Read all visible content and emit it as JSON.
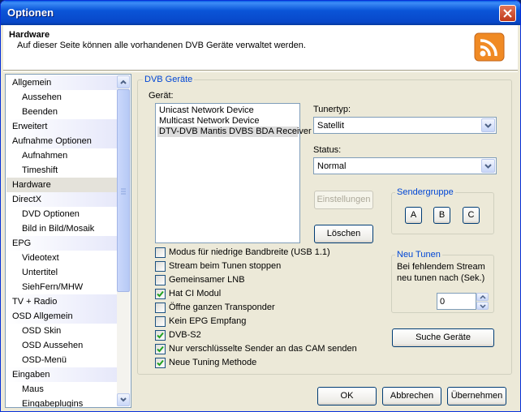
{
  "window": {
    "title": "Optionen"
  },
  "header": {
    "title": "Hardware",
    "description": "Auf dieser Seite können alle vorhandenen DVB Geräte verwaltet werden."
  },
  "nav": {
    "items": [
      {
        "label": "Allgemein",
        "kind": "cat"
      },
      {
        "label": "Aussehen",
        "kind": "sub"
      },
      {
        "label": "Beenden",
        "kind": "sub"
      },
      {
        "label": "Erweitert",
        "kind": "cat"
      },
      {
        "label": "Aufnahme Optionen",
        "kind": "cat"
      },
      {
        "label": "Aufnahmen",
        "kind": "sub"
      },
      {
        "label": "Timeshift",
        "kind": "sub"
      },
      {
        "label": "Hardware",
        "kind": "cat",
        "selected": true
      },
      {
        "label": "DirectX",
        "kind": "cat"
      },
      {
        "label": "DVD Optionen",
        "kind": "sub"
      },
      {
        "label": "Bild in Bild/Mosaik",
        "kind": "sub"
      },
      {
        "label": "EPG",
        "kind": "cat"
      },
      {
        "label": "Videotext",
        "kind": "sub"
      },
      {
        "label": "Untertitel",
        "kind": "sub"
      },
      {
        "label": "SiehFern/MHW",
        "kind": "sub"
      },
      {
        "label": "TV + Radio",
        "kind": "cat"
      },
      {
        "label": "OSD Allgemein",
        "kind": "cat"
      },
      {
        "label": "OSD Skin",
        "kind": "sub"
      },
      {
        "label": "OSD Aussehen",
        "kind": "sub"
      },
      {
        "label": "OSD-Menü",
        "kind": "sub"
      },
      {
        "label": "Eingaben",
        "kind": "cat"
      },
      {
        "label": "Maus",
        "kind": "sub"
      },
      {
        "label": "Eingabeplugins",
        "kind": "sub"
      }
    ]
  },
  "dvb": {
    "group_label": "DVB Geräte",
    "device_label": "Gerät:",
    "devices": [
      {
        "label": "Unicast Network Device",
        "selected": false
      },
      {
        "label": "Multicast Network Device",
        "selected": false
      },
      {
        "label": "DTV-DVB Mantis DVBS BDA Receiver",
        "selected": true
      }
    ],
    "tunertype_label": "Tunertyp:",
    "tunertype_value": "Satellit",
    "status_label": "Status:",
    "status_value": "Normal",
    "settings_button": "Einstellungen",
    "delete_button": "Löschen",
    "sendergruppe": {
      "label": "Sendergruppe",
      "buttons": [
        "A",
        "B",
        "C"
      ]
    },
    "neu_tunen": {
      "label": "Neu Tunen",
      "text_line1": "Bei fehlendem Stream",
      "text_line2": "neu tunen nach (Sek.)",
      "value": "0"
    },
    "search_button": "Suche Geräte",
    "options": [
      {
        "label": "Modus für niedrige Bandbreite (USB 1.1)",
        "checked": false
      },
      {
        "label": "Stream beim Tunen stoppen",
        "checked": false
      },
      {
        "label": "Gemeinsamer LNB",
        "checked": false
      },
      {
        "label": "Hat CI Modul",
        "checked": true
      },
      {
        "label": "Öffne ganzen Transponder",
        "checked": false
      },
      {
        "label": "Kein EPG Empfang",
        "checked": false
      },
      {
        "label": "DVB-S2",
        "checked": true
      },
      {
        "label": "Nur verschlüsselte Sender an das CAM senden",
        "checked": true
      },
      {
        "label": "Neue Tuning Methode",
        "checked": true
      }
    ]
  },
  "footer": {
    "ok": "OK",
    "cancel": "Abbrechen",
    "apply": "Übernehmen"
  },
  "colors": {
    "accent_blue": "#0046d5",
    "rss_orange": "#f08a24"
  }
}
